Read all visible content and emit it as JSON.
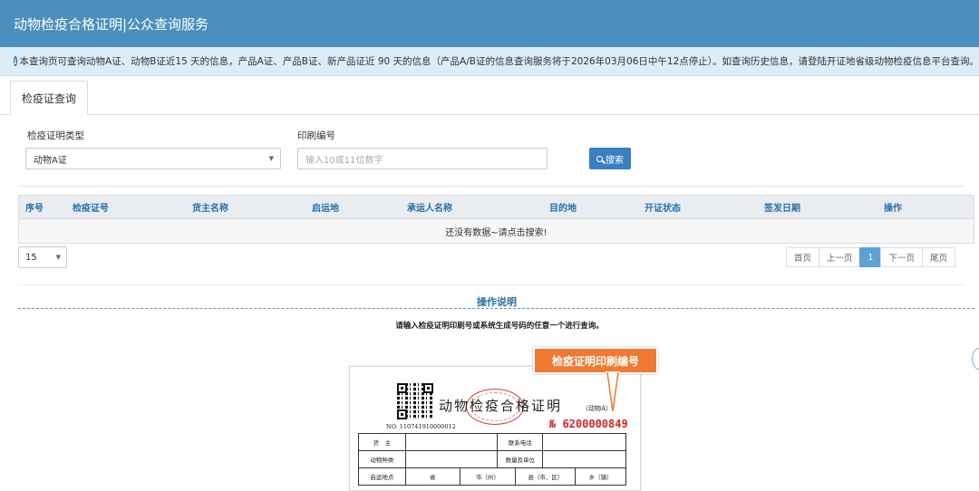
{
  "header": {
    "title": "动物检疫合格证明|公众查询服务"
  },
  "notice": {
    "text": "本查询页可查询动物A证、动物B证近15 天的信息，产品A证、产品B证、新产品证近 90 天的信息（产品A/B证的信息查询服务将于2026年03月06日中午12点停止）。如查询历史信息，请登陆开证地省级动物检疫信息平台查询。"
  },
  "tabs": [
    {
      "label": "检疫证查询"
    }
  ],
  "form": {
    "type_label": "检疫证明类型",
    "type_value": "动物A证",
    "number_label": "印刷编号",
    "number_placeholder": "输入10或11位数字",
    "search_label": "搜索"
  },
  "table": {
    "columns": [
      "序号",
      "检疫证号",
      "货主名称",
      "启运地",
      "承运人名称",
      "目的地",
      "开证状态",
      "签发日期",
      "操作"
    ],
    "empty_text": "还没有数据~请点击搜索!"
  },
  "pagination": {
    "page_size": "15",
    "first": "首页",
    "prev": "上一页",
    "current": "1",
    "next": "下一页",
    "last": "尾页"
  },
  "instructions": {
    "title": "操作说明",
    "text": "请输入检疫证明印刷号或系统生成号码的任意一个进行查询。",
    "callout": "检疫证明印刷编号",
    "cert_title": "动物检疫合格证明",
    "cert_subtitle": "（动物A）",
    "cert_no": "NO. 110741910000012",
    "cert_print_no": "№ 6200000849",
    "cert_rows": [
      [
        "货　主",
        "",
        "联系电话",
        ""
      ],
      [
        "动物种类",
        "",
        "数量及单位",
        ""
      ],
      [
        "启运地点",
        "省",
        "市（州）",
        "县（市、区）",
        "乡（镇）"
      ]
    ]
  },
  "colors": {
    "header": "#4b8fbe",
    "accent": "#2a6fa8",
    "callout": "#f07a31",
    "print_no": "#d62424"
  }
}
